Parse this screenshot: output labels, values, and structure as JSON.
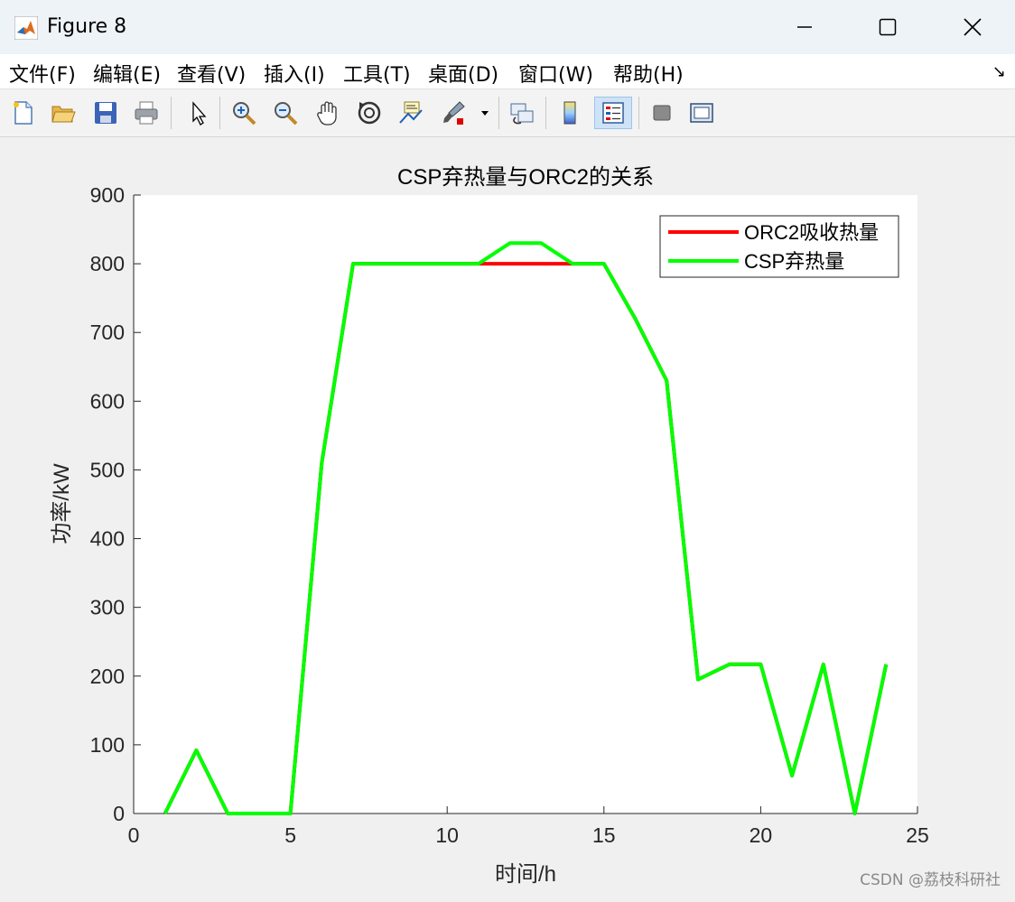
{
  "window": {
    "title": "Figure 8",
    "controls": [
      "minimize",
      "maximize",
      "close"
    ]
  },
  "menu": [
    {
      "label": "文件(F)",
      "name": "menu-file"
    },
    {
      "label": "编辑(E)",
      "name": "menu-edit"
    },
    {
      "label": "查看(V)",
      "name": "menu-view"
    },
    {
      "label": "插入(I)",
      "name": "menu-insert"
    },
    {
      "label": "工具(T)",
      "name": "menu-tools"
    },
    {
      "label": "桌面(D)",
      "name": "menu-desktop"
    },
    {
      "label": "窗口(W)",
      "name": "menu-window"
    },
    {
      "label": "帮助(H)",
      "name": "menu-help"
    }
  ],
  "menu_overflow_glyph": "↘",
  "toolbar": [
    "new-figure-icon",
    "open-file-icon",
    "save-icon",
    "print-icon",
    "pointer-icon",
    "zoom-in-icon",
    "zoom-out-icon",
    "pan-hand-icon",
    "rotate-3d-icon",
    "data-cursor-icon",
    "brush-icon",
    "link-plot-icon",
    "colorbar-icon",
    "legend-icon",
    "hide-plot-tools-icon",
    "show-plot-tools-icon"
  ],
  "chart_data": {
    "type": "line",
    "title": "CSP弃热量与ORC2的关系",
    "xlabel": "时间/h",
    "ylabel": "功率/kW",
    "xlim": [
      0,
      25
    ],
    "ylim": [
      0,
      900
    ],
    "xticks": [
      0,
      5,
      10,
      15,
      20,
      25
    ],
    "yticks": [
      0,
      100,
      200,
      300,
      400,
      500,
      600,
      700,
      800,
      900
    ],
    "grid": false,
    "legend_position": "top-right",
    "x": [
      1,
      2,
      3,
      4,
      5,
      6,
      7,
      8,
      9,
      10,
      11,
      12,
      13,
      14,
      15,
      16,
      17,
      18,
      19,
      20,
      21,
      22,
      23,
      24
    ],
    "series": [
      {
        "name": "ORC2吸收热量",
        "color": "#ff0000",
        "values": [
          0,
          92,
          0,
          0,
          0,
          510,
          800,
          800,
          800,
          800,
          800,
          800,
          800,
          800,
          800,
          720,
          630,
          195,
          217,
          217,
          55,
          217,
          0,
          217
        ]
      },
      {
        "name": "CSP弃热量",
        "color": "#00ff00",
        "values": [
          0,
          92,
          0,
          0,
          0,
          510,
          800,
          800,
          800,
          800,
          800,
          830,
          830,
          800,
          800,
          720,
          630,
          195,
          217,
          217,
          55,
          217,
          0,
          217
        ]
      }
    ]
  },
  "watermark": "CSDN @荔枝科研社"
}
